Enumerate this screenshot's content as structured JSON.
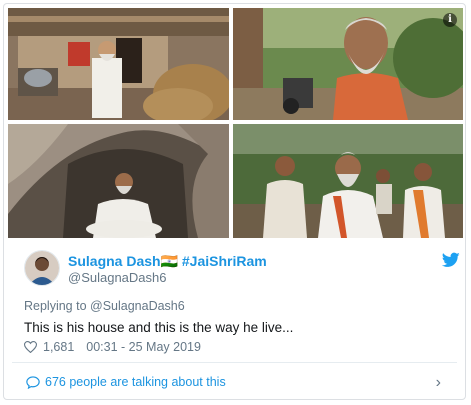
{
  "tweet": {
    "display_name": "Sulagna Dash🇮🇳 #JaiShriRam",
    "handle": "@SulagnaDash6",
    "replying_to": "Replying to @SulagnaDash6",
    "text": "This is his house and this is the way he live...",
    "likes": "1,681",
    "timestamp": "00:31 - 25 May 2019",
    "talking": "676 people are talking about this"
  },
  "icons": {
    "info": "info-icon",
    "bird": "twitter-bird-icon",
    "heart": "heart-icon",
    "comment": "comment-bubble-icon",
    "chevron": "chevron-right-icon"
  },
  "colors": {
    "link_blue": "#1c94e0",
    "muted_gray": "#657786"
  }
}
